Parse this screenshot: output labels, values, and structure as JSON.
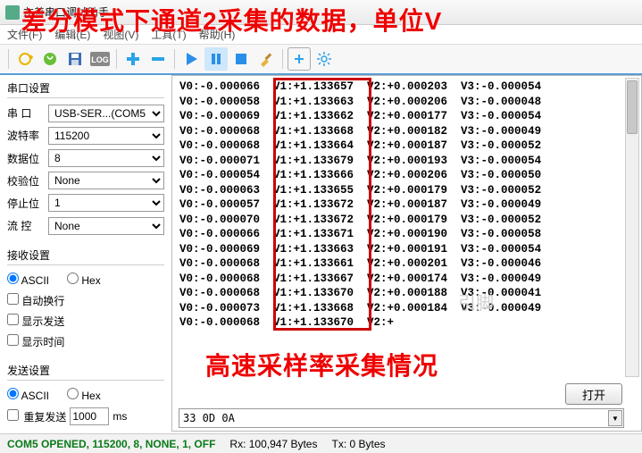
{
  "window": {
    "title": "友善串口调试助手"
  },
  "menu": {
    "file": "文件(F)",
    "edit": "编辑(E)",
    "view": "视图(V)",
    "tools": "工具(T)",
    "help": "帮助(H)"
  },
  "annotations": {
    "top": "差分模式下通道2采集的数据，单位V",
    "bottom": "高速采样率采集情况"
  },
  "serial": {
    "group": "串口设置",
    "port_label": "串  口",
    "port_value": "USB-SER...(COM5",
    "baud_label": "波特率",
    "baud_value": "115200",
    "databits_label": "数据位",
    "databits_value": "8",
    "parity_label": "校验位",
    "parity_value": "None",
    "stopbits_label": "停止位",
    "stopbits_value": "1",
    "flow_label": "流  控",
    "flow_value": "None"
  },
  "recv": {
    "group": "接收设置",
    "ascii": "ASCII",
    "hex": "Hex",
    "autowrap": "自动换行",
    "showsend": "显示发送",
    "showtime": "显示时间"
  },
  "send": {
    "group": "发送设置",
    "ascii": "ASCII",
    "hex": "Hex",
    "repeat": "重复发送",
    "interval": "1000",
    "ms": "ms"
  },
  "tx": {
    "value": "33 0D 0A"
  },
  "open_btn": "打开",
  "status": {
    "conn": "COM5 OPENED, 115200, 8, NONE, 1, OFF",
    "rx": "Rx: 100,947 Bytes",
    "tx": "Tx: 0 Bytes"
  },
  "data_rows": [
    {
      "v0": "-0.000066",
      "v1": "+1.133657",
      "v2": "+0.000203",
      "v3": "-0.000054"
    },
    {
      "v0": "-0.000058",
      "v1": "+1.133663",
      "v2": "+0.000206",
      "v3": "-0.000048"
    },
    {
      "v0": "-0.000069",
      "v1": "+1.133662",
      "v2": "+0.000177",
      "v3": "-0.000054"
    },
    {
      "v0": "-0.000068",
      "v1": "+1.133668",
      "v2": "+0.000182",
      "v3": "-0.000049"
    },
    {
      "v0": "-0.000068",
      "v1": "+1.133664",
      "v2": "+0.000187",
      "v3": "-0.000052"
    },
    {
      "v0": "-0.000071",
      "v1": "+1.133679",
      "v2": "+0.000193",
      "v3": "-0.000054"
    },
    {
      "v0": "-0.000054",
      "v1": "+1.133666",
      "v2": "+0.000206",
      "v3": "-0.000050"
    },
    {
      "v0": "-0.000063",
      "v1": "+1.133655",
      "v2": "+0.000179",
      "v3": "-0.000052"
    },
    {
      "v0": "-0.000057",
      "v1": "+1.133672",
      "v2": "+0.000187",
      "v3": "-0.000049"
    },
    {
      "v0": "-0.000070",
      "v1": "+1.133672",
      "v2": "+0.000179",
      "v3": "-0.000052"
    },
    {
      "v0": "-0.000066",
      "v1": "+1.133671",
      "v2": "+0.000190",
      "v3": "-0.000058"
    },
    {
      "v0": "-0.000069",
      "v1": "+1.133663",
      "v2": "+0.000191",
      "v3": "-0.000054"
    },
    {
      "v0": "-0.000068",
      "v1": "+1.133661",
      "v2": "+0.000201",
      "v3": "-0.000046"
    },
    {
      "v0": "-0.000068",
      "v1": "+1.133667",
      "v2": "+0.000174",
      "v3": "-0.000049"
    },
    {
      "v0": "-0.000068",
      "v1": "+1.133670",
      "v2": "+0.000188",
      "v3": "-0.000041"
    },
    {
      "v0": "-0.000073",
      "v1": "+1.133668",
      "v2": "+0.000184",
      "v3": "-0.000049"
    },
    {
      "v0": "-0.000068",
      "v1": "+1.133670",
      "v2": "+",
      "v3": ""
    }
  ]
}
